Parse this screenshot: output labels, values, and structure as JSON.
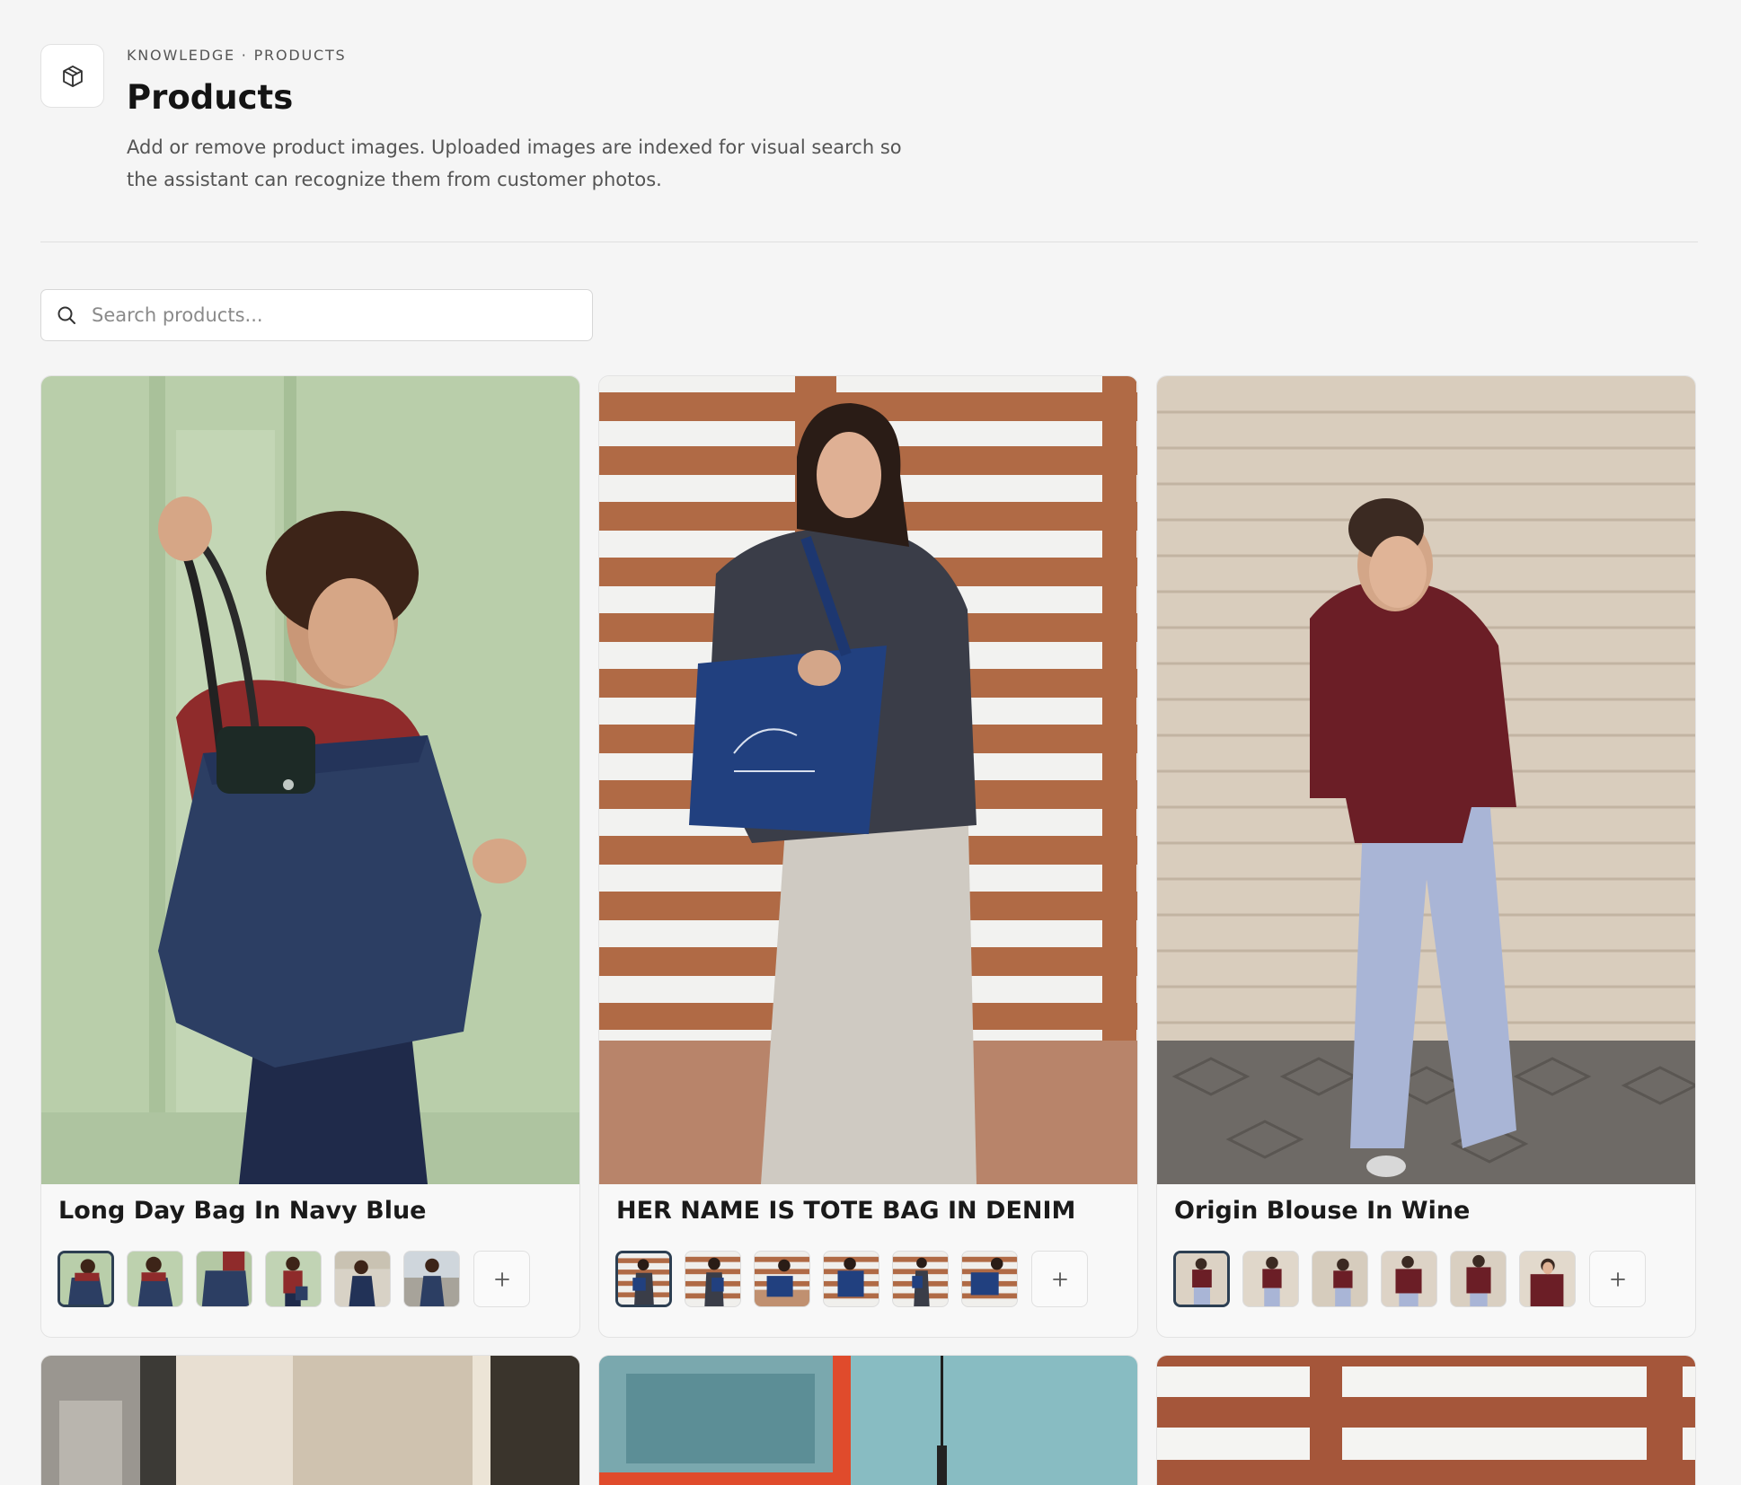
{
  "header": {
    "breadcrumb": "KNOWLEDGE · PRODUCTS",
    "title": "Products",
    "description": "Add or remove product images. Uploaded images are indexed for visual search so the assistant can recognize them from customer photos.",
    "icon": "package-icon"
  },
  "search": {
    "placeholder": "Search products...",
    "value": "",
    "icon": "search-icon"
  },
  "products": [
    {
      "name": "Long Day Bag In Navy Blue",
      "thumbnail_count": 6,
      "active_thumbnail": 1,
      "photo_colors": {
        "background": "#b9ceaa",
        "garment": "#8f2b2b",
        "product": "#2c3e63"
      }
    },
    {
      "name": "HER NAME IS TOTE BAG IN DENIM",
      "thumbnail_count": 6,
      "active_thumbnail": 1,
      "photo_colors": {
        "background": "#b06a45",
        "garment": "#3a3d48",
        "product": "#21407f"
      }
    },
    {
      "name": "Origin Blouse In Wine",
      "thumbnail_count": 6,
      "active_thumbnail": 1,
      "photo_colors": {
        "background": "#d9cdbd",
        "garment": "#6b1e26",
        "product": "#a9b5d6"
      }
    }
  ],
  "colors": {
    "page_background": "#f5f5f5",
    "active_thumb_border": "#2d3f52",
    "text_primary": "#1a1a1a",
    "text_secondary": "#545454"
  }
}
